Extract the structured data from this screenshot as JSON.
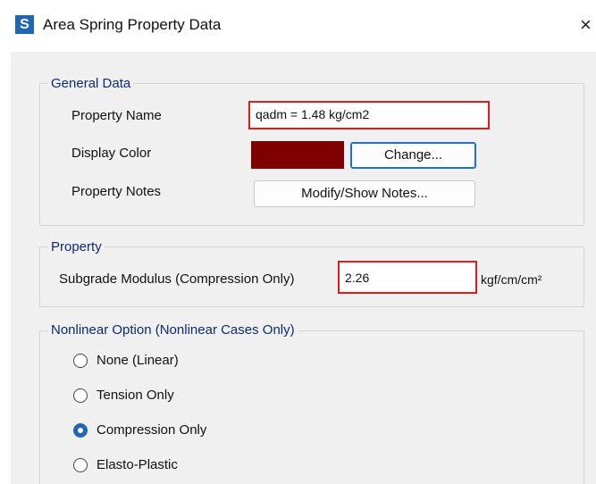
{
  "window": {
    "title": "Area Spring Property Data",
    "app_icon_letter": "S",
    "close_glyph": "×"
  },
  "general_data": {
    "legend": "General Data",
    "property_name_label": "Property Name",
    "property_name_value": "qadm = 1.48 kg/cm2",
    "display_color_label": "Display Color",
    "display_color": "#7f0000",
    "change_button": "Change...",
    "property_notes_label": "Property Notes",
    "notes_button": "Modify/Show Notes..."
  },
  "property": {
    "legend": "Property",
    "subgrade_label": "Subgrade Modulus  (Compression Only)",
    "subgrade_value": "2.26",
    "subgrade_units": "kgf/cm/cm²"
  },
  "nonlinear": {
    "legend": "Nonlinear Option  (Nonlinear Cases Only)",
    "options": [
      {
        "label": "None (Linear)",
        "checked": false
      },
      {
        "label": "Tension Only",
        "checked": false
      },
      {
        "label": "Compression Only",
        "checked": true
      },
      {
        "label": "Elasto-Plastic",
        "checked": false
      }
    ]
  },
  "colors": {
    "highlight": "#e01b1b",
    "accent": "#1f67b4",
    "legend_text": "#0c2a78"
  }
}
